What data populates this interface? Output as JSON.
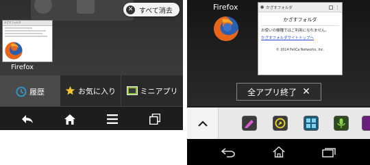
{
  "left": {
    "clear_all_label": "すべて消去",
    "thumb": {
      "url_text": "かざすフォルダ",
      "title": "Firefox"
    },
    "tabs": [
      {
        "label": "履歴",
        "icon": "clock-icon"
      },
      {
        "label": "お気に入り",
        "icon": "star-icon"
      },
      {
        "label": "ミニアプリ",
        "icon": "mini-app-icon"
      }
    ],
    "nav": [
      "back-icon",
      "home-icon",
      "menu-icon",
      "recent-apps-icon"
    ]
  },
  "right": {
    "app_title": "Firefox",
    "card": {
      "url_text": "かざすフォルダ",
      "page_title": "かざすフォルダ",
      "body_text": "お使いの機種ではご利用になれません。",
      "link_text": "かざすフォルダサイトトップへ",
      "copyright": "© 2014 FeliCa Networks, Inc."
    },
    "exit_all_label": "全アプリ終了",
    "apps": [
      "pen-app-icon",
      "compass-app-icon",
      "calculator-app-icon",
      "voice-app-icon",
      "purple-app-icon"
    ],
    "nav": [
      "back-icon",
      "home-icon",
      "recent-apps-icon"
    ]
  },
  "colors": {
    "accent_blue": "#2f9bd6",
    "star_yellow": "#f2c230",
    "mini_green": "#8ec63f"
  }
}
